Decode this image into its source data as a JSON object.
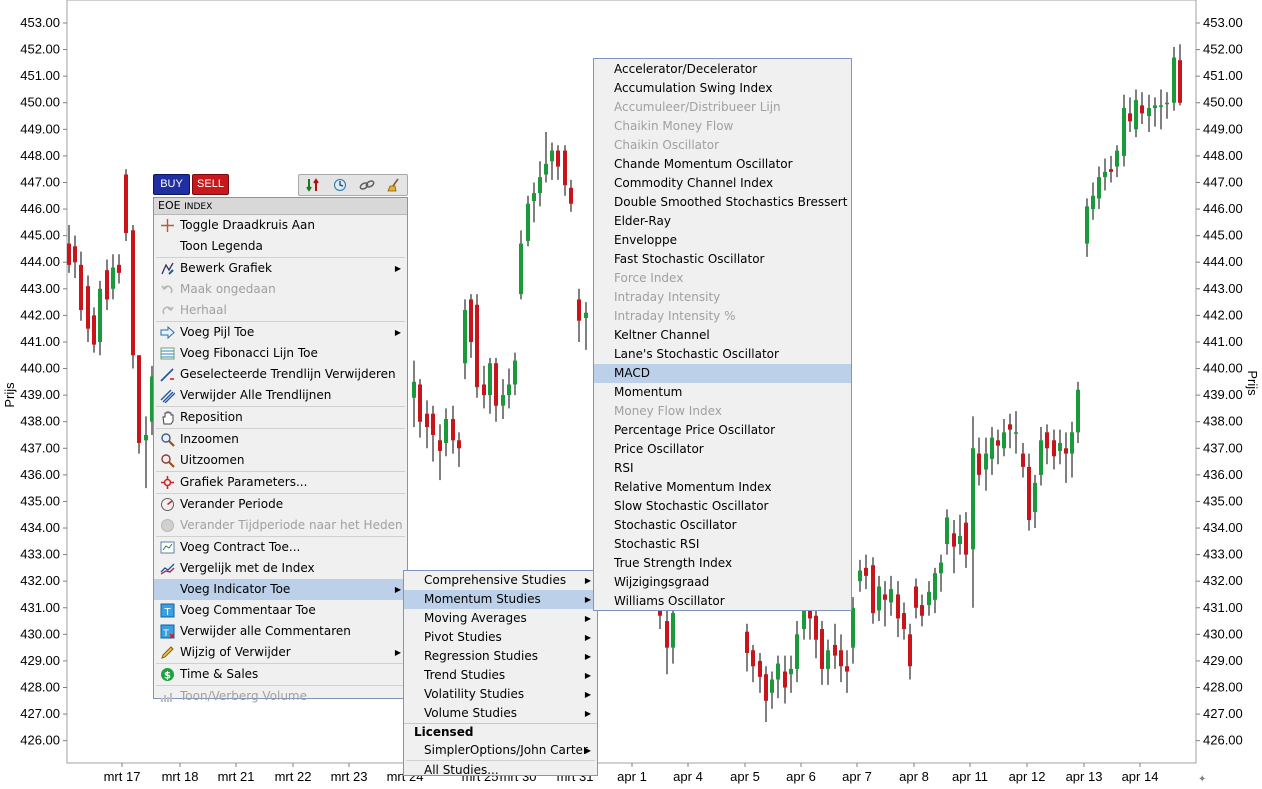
{
  "chart_data": {
    "type": "candlestick",
    "ylabel": "Prijs",
    "ylim": [
      425.5,
      453.5
    ],
    "y_ticks": [
      "453.00",
      "452.00",
      "451.00",
      "450.00",
      "449.00",
      "448.00",
      "447.00",
      "446.00",
      "445.00",
      "444.00",
      "443.00",
      "442.00",
      "441.00",
      "440.00",
      "439.00",
      "438.00",
      "437.00",
      "436.00",
      "435.00",
      "434.00",
      "433.00",
      "432.00",
      "431.00",
      "430.00",
      "429.00",
      "428.00",
      "427.00",
      "426.00"
    ],
    "x_ticks": [
      "mrt 17",
      "mrt 18",
      "mrt 21",
      "mrt 22",
      "mrt 23",
      "mrt 24",
      "mrt 25",
      "mrt 30",
      "mrt 31",
      "apr 1",
      "apr 4",
      "apr 5",
      "apr 6",
      "apr 7",
      "apr 8",
      "apr 11",
      "apr 12",
      "apr 13",
      "apr 14"
    ],
    "colors": {
      "up": "#1a9a3a",
      "down": "#c8141a",
      "wick": "#000000",
      "grid": "#d8d8d8"
    }
  },
  "toolbar": {
    "buy_label": "BUY",
    "sell_label": "SELL",
    "tools": [
      "sort-arrows-icon",
      "clock-icon",
      "link-icon",
      "broom-icon"
    ]
  },
  "context_menu": {
    "header_main": "EOE",
    "header_small": "INDEX",
    "items": [
      {
        "label": "Toggle Draadkruis Aan",
        "icon": "crosshair-icon",
        "disabled": false,
        "sub": false
      },
      {
        "label": "Toon Legenda",
        "icon": "",
        "disabled": false,
        "sub": false
      },
      {
        "label": "Bewerk Grafiek",
        "icon": "edit-chart-icon",
        "disabled": false,
        "sub": true
      },
      {
        "label": "Maak ongedaan",
        "icon": "undo-icon",
        "disabled": true,
        "sub": false
      },
      {
        "label": "Herhaal",
        "icon": "redo-icon",
        "disabled": true,
        "sub": false
      },
      {
        "label": "Voeg Pijl Toe",
        "icon": "arrow-icon",
        "disabled": false,
        "sub": true
      },
      {
        "label": "Voeg Fibonacci Lijn Toe",
        "icon": "fibonacci-icon",
        "disabled": false,
        "sub": false
      },
      {
        "label": "Geselecteerde Trendlijn Verwijderen",
        "icon": "trendline-delete-icon",
        "disabled": false,
        "sub": false
      },
      {
        "label": "Verwijder Alle Trendlijnen",
        "icon": "trendlines-delete-icon",
        "disabled": false,
        "sub": false
      },
      {
        "label": "Reposition",
        "icon": "hand-icon",
        "disabled": false,
        "sub": false
      },
      {
        "label": "Inzoomen",
        "icon": "zoom-in-icon",
        "disabled": false,
        "sub": false
      },
      {
        "label": "Uitzoomen",
        "icon": "zoom-out-icon",
        "disabled": false,
        "sub": false
      },
      {
        "label": "Grafiek Parameters...",
        "icon": "parameters-icon",
        "disabled": false,
        "sub": false
      },
      {
        "label": "Verander Periode",
        "icon": "period-icon",
        "disabled": false,
        "sub": false
      },
      {
        "label": "Verander Tijdperiode naar het Heden",
        "icon": "period-now-icon",
        "disabled": true,
        "sub": false
      },
      {
        "label": "Voeg Contract Toe...",
        "icon": "add-contract-icon",
        "disabled": false,
        "sub": false
      },
      {
        "label": "Vergelijk met de Index",
        "icon": "compare-icon",
        "disabled": false,
        "sub": false
      },
      {
        "label": "Voeg Indicator Toe",
        "icon": "",
        "disabled": false,
        "sub": true,
        "active": true
      },
      {
        "label": "Voeg Commentaar Toe",
        "icon": "comment-icon",
        "disabled": false,
        "sub": false
      },
      {
        "label": "Verwijder alle Commentaren",
        "icon": "comments-delete-icon",
        "disabled": false,
        "sub": false
      },
      {
        "label": "Wijzig of Verwijder",
        "icon": "pencil-icon",
        "disabled": false,
        "sub": true
      },
      {
        "label": "Time & Sales",
        "icon": "time-sales-icon",
        "disabled": false,
        "sub": false
      },
      {
        "label": "Toon/Verberg Volume",
        "icon": "volume-icon",
        "disabled": true,
        "sub": false
      }
    ]
  },
  "indicator_menu": {
    "items": [
      {
        "label": "Comprehensive Studies",
        "sub": true
      },
      {
        "label": "Momentum Studies",
        "sub": true,
        "active": true
      },
      {
        "label": "Moving Averages",
        "sub": true
      },
      {
        "label": "Pivot Studies",
        "sub": true
      },
      {
        "label": "Regression Studies",
        "sub": true
      },
      {
        "label": "Trend Studies",
        "sub": true
      },
      {
        "label": "Volatility Studies",
        "sub": true
      },
      {
        "label": "Volume Studies",
        "sub": true
      }
    ],
    "group_label": "Licensed",
    "licensed": [
      {
        "label": "SimplerOptions/John Carter",
        "sub": true
      }
    ],
    "all_studies": "All Studies..."
  },
  "momentum_menu": {
    "items": [
      {
        "label": "Accelerator/Decelerator",
        "disabled": false
      },
      {
        "label": "Accumulation Swing Index",
        "disabled": false
      },
      {
        "label": "Accumuleer/Distribueer Lijn",
        "disabled": true
      },
      {
        "label": "Chaikin Money Flow",
        "disabled": true
      },
      {
        "label": "Chaikin Oscillator",
        "disabled": true
      },
      {
        "label": "Chande Momentum Oscillator",
        "disabled": false
      },
      {
        "label": "Commodity Channel Index",
        "disabled": false
      },
      {
        "label": "Double Smoothed Stochastics Bressert",
        "disabled": false
      },
      {
        "label": "Elder-Ray",
        "disabled": false
      },
      {
        "label": "Enveloppe",
        "disabled": false
      },
      {
        "label": "Fast Stochastic Oscillator",
        "disabled": false
      },
      {
        "label": "Force Index",
        "disabled": true
      },
      {
        "label": "Intraday Intensity",
        "disabled": true
      },
      {
        "label": "Intraday Intensity %",
        "disabled": true
      },
      {
        "label": "Keltner Channel",
        "disabled": false
      },
      {
        "label": "Lane's Stochastic Oscillator",
        "disabled": false
      },
      {
        "label": "MACD",
        "disabled": false,
        "active": true
      },
      {
        "label": "Momentum",
        "disabled": false
      },
      {
        "label": "Money Flow Index",
        "disabled": true
      },
      {
        "label": "Percentage Price Oscillator",
        "disabled": false
      },
      {
        "label": "Price Oscillator",
        "disabled": false
      },
      {
        "label": "RSI",
        "disabled": false
      },
      {
        "label": "Relative Momentum Index",
        "disabled": false
      },
      {
        "label": "Slow Stochastic Oscillator",
        "disabled": false
      },
      {
        "label": "Stochastic Oscillator",
        "disabled": false
      },
      {
        "label": "Stochastic RSI",
        "disabled": false
      },
      {
        "label": "True Strength Index",
        "disabled": false
      },
      {
        "label": "Wijzigingsgraad",
        "disabled": false
      },
      {
        "label": "Williams Oscillator",
        "disabled": false
      }
    ]
  }
}
